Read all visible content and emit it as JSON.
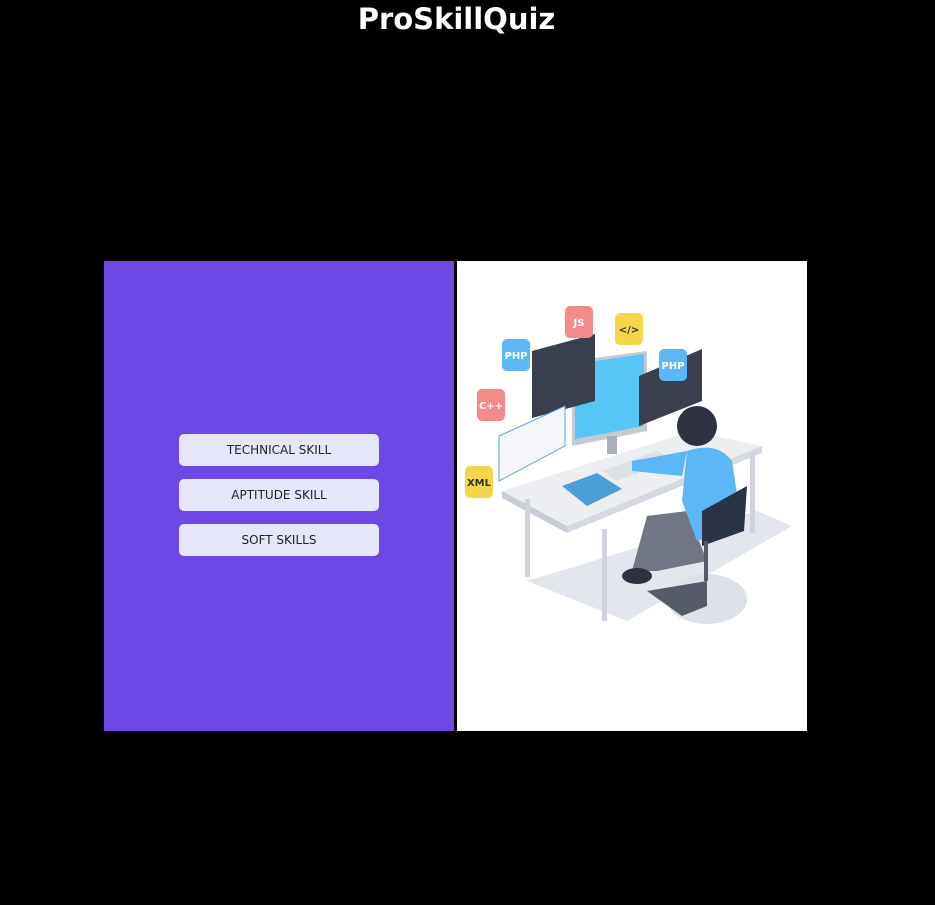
{
  "header": {
    "title": "ProSkillQuiz"
  },
  "menu": {
    "buttons": [
      {
        "label": "TECHNICAL SKILL"
      },
      {
        "label": "APTITUDE SKILL"
      },
      {
        "label": "SOFT SKILLS"
      }
    ]
  },
  "illustration": {
    "labels": [
      "PHP",
      "JS",
      "</>",
      "C++",
      "XML",
      "PHP"
    ]
  },
  "colors": {
    "panel": "#6e48e5",
    "button": "#e6e6fa",
    "background": "#000000"
  }
}
